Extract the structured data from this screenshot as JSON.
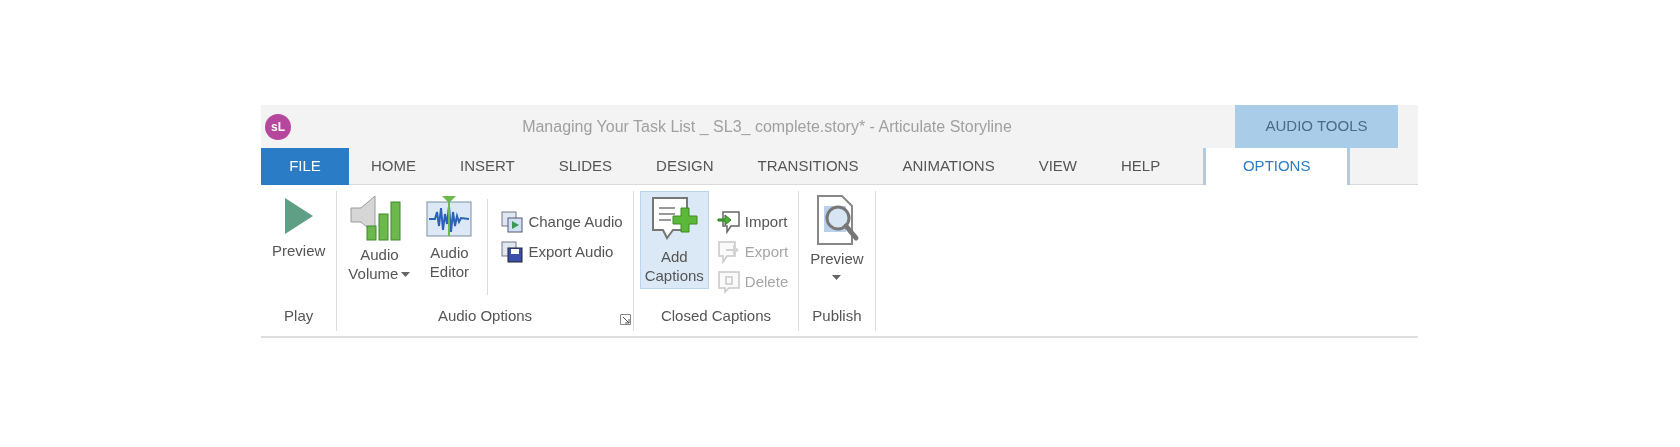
{
  "logo_text": "sL",
  "window": {
    "title": "Managing Your Task List _ SL3_ complete.story* -  Articulate Storyline"
  },
  "context_header": "AUDIO TOOLS",
  "tabs": [
    {
      "label": "FILE",
      "kind": "file",
      "selected": false
    },
    {
      "label": "HOME",
      "kind": "tab",
      "selected": false
    },
    {
      "label": "INSERT",
      "kind": "tab",
      "selected": false
    },
    {
      "label": "SLIDES",
      "kind": "tab",
      "selected": false
    },
    {
      "label": "DESIGN",
      "kind": "tab",
      "selected": false
    },
    {
      "label": "TRANSITIONS",
      "kind": "tab",
      "selected": false
    },
    {
      "label": "ANIMATIONS",
      "kind": "tab",
      "selected": false
    },
    {
      "label": "VIEW",
      "kind": "tab",
      "selected": false
    },
    {
      "label": "HELP",
      "kind": "tab",
      "selected": false
    },
    {
      "label": "OPTIONS",
      "kind": "context",
      "selected": true
    }
  ],
  "groups": [
    {
      "label": "Play",
      "launcher": false,
      "items": [
        {
          "kind": "large",
          "lines": [
            "Preview"
          ],
          "dropdown": false,
          "highlighted": false
        }
      ]
    },
    {
      "label": "Audio Options",
      "launcher": true,
      "items": [
        {
          "kind": "large",
          "lines": [
            "Audio",
            "Volume"
          ],
          "dropdown": true,
          "highlighted": false
        },
        {
          "kind": "large",
          "lines": [
            "Audio",
            "Editor"
          ],
          "dropdown": false,
          "highlighted": false
        },
        {
          "kind": "separator"
        },
        {
          "kind": "stack",
          "buttons": [
            {
              "label": "Change Audio",
              "disabled": false
            },
            {
              "label": "Export Audio",
              "disabled": false
            }
          ]
        }
      ]
    },
    {
      "label": "Closed Captions",
      "launcher": false,
      "items": [
        {
          "kind": "large",
          "lines": [
            "Add",
            "Captions"
          ],
          "dropdown": false,
          "highlighted": true
        },
        {
          "kind": "stack",
          "buttons": [
            {
              "label": "Import",
              "disabled": false
            },
            {
              "label": "Export",
              "disabled": true
            },
            {
              "label": "Delete",
              "disabled": true
            }
          ]
        }
      ]
    },
    {
      "label": "Publish",
      "launcher": false,
      "items": [
        {
          "kind": "large",
          "lines": [
            "Preview"
          ],
          "dropdown": true,
          "dropdown_below": true,
          "highlighted": false
        }
      ]
    }
  ]
}
